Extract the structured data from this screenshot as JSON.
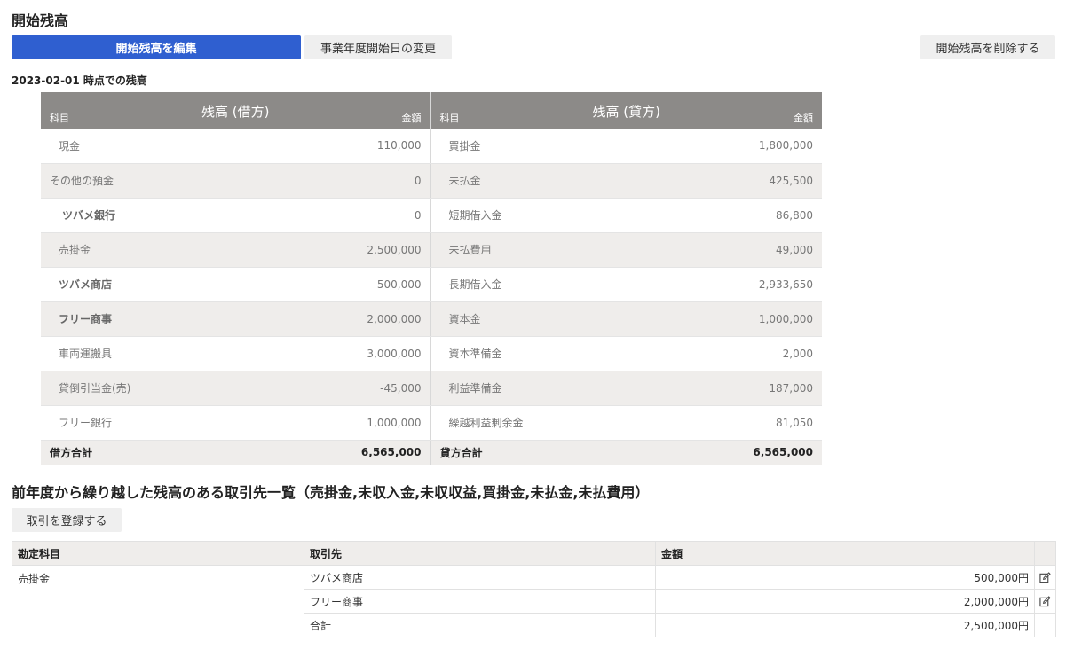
{
  "page": {
    "title": "開始残高",
    "edit_button": "開始残高を編集",
    "fiscal_year_button": "事業年度開始日の変更",
    "delete_button": "開始残高を削除する",
    "as_of": "2023-02-01 時点での残高"
  },
  "balance": {
    "debit_header": "残高 (借方)",
    "credit_header": "残高 (貸方)",
    "account_label": "科目",
    "amount_label": "金額",
    "rows": [
      {
        "d_name": "現金",
        "d_amt": "110,000",
        "c_name": "買掛金",
        "c_amt": "1,800,000"
      },
      {
        "d_name": "その他の預金",
        "d_amt": "0",
        "c_name": "未払金",
        "c_amt": "425,500"
      },
      {
        "d_name": "ツバメ銀行",
        "d_amt": "0",
        "c_name": "短期借入金",
        "c_amt": "86,800"
      },
      {
        "d_name": "売掛金",
        "d_amt": "2,500,000",
        "c_name": "未払費用",
        "c_amt": "49,000"
      },
      {
        "d_name": "ツバメ商店",
        "d_amt": "500,000",
        "c_name": "長期借入金",
        "c_amt": "2,933,650"
      },
      {
        "d_name": "フリー商事",
        "d_amt": "2,000,000",
        "c_name": "資本金",
        "c_amt": "1,000,000"
      },
      {
        "d_name": "車両運搬具",
        "d_amt": "3,000,000",
        "c_name": "資本準備金",
        "c_amt": "2,000"
      },
      {
        "d_name": "貸倒引当金(売)",
        "d_amt": "-45,000",
        "c_name": "利益準備金",
        "c_amt": "187,000"
      },
      {
        "d_name": "フリー銀行",
        "d_amt": "1,000,000",
        "c_name": "繰越利益剰余金",
        "c_amt": "81,050"
      }
    ],
    "debit_total_label": "借方合計",
    "debit_total": "6,565,000",
    "credit_total_label": "貸方合計",
    "credit_total": "6,565,000"
  },
  "partners": {
    "section_title": "前年度から繰り越した残高のある取引先一覧（売掛金,未収入金,未収収益,買掛金,未払金,未払費用）",
    "register_button": "取引を登録する",
    "headers": {
      "account": "勘定科目",
      "partner": "取引先",
      "amount": "金額"
    },
    "account": "売掛金",
    "rows": [
      {
        "partner": "ツバメ商店",
        "amount": "500,000円",
        "editable": true
      },
      {
        "partner": "フリー商事",
        "amount": "2,000,000円",
        "editable": true
      },
      {
        "partner": "合計",
        "amount": "2,500,000円",
        "editable": false
      }
    ]
  },
  "colors": {
    "primary": "#2f5fd0",
    "header_gray": "#8c8a88",
    "row_gray": "#efedeb"
  }
}
